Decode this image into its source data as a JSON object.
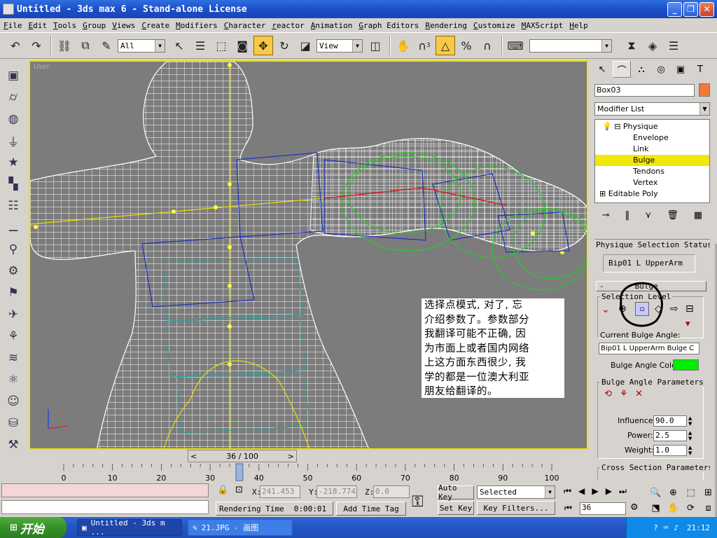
{
  "window": {
    "title": "Untitled - 3ds max 6 - Stand-alone License",
    "minimize": "_",
    "restore": "❐",
    "close": "✕"
  },
  "menu": [
    "File",
    "Edit",
    "Tools",
    "Group",
    "Views",
    "Create",
    "Modifiers",
    "Character",
    "reactor",
    "Animation",
    "Graph Editors",
    "Rendering",
    "Customize",
    "MAXScript",
    "Help"
  ],
  "toolbar": {
    "selection_filter": "All",
    "reference_coord": "View",
    "snap_label": "3"
  },
  "viewport": {
    "label": "User",
    "note_lines": [
      "选择点模式, 对了, 忘",
      "介绍参数了。参数部分",
      "我翻译可能不正确, 因",
      "为市面上或者国内网络",
      "上这方面东西很少, 我",
      "学的都是一位澳大利亚",
      "朋友给翻译的。"
    ]
  },
  "command_panel": {
    "object_name": "Box03",
    "object_color": "#f07a3c",
    "modifier_list": "Modifier List",
    "stack": [
      {
        "label": "Physique",
        "level": 0,
        "expand": "⊟"
      },
      {
        "label": "Envelope",
        "level": 1
      },
      {
        "label": "Link",
        "level": 1
      },
      {
        "label": "Bulge",
        "level": 1,
        "highlight": true
      },
      {
        "label": "Tendons",
        "level": 1
      },
      {
        "label": "Vertex",
        "level": 1
      },
      {
        "label": "Editable Poly",
        "level": 0,
        "expand": "⊞"
      }
    ],
    "physique_rollout": "Physique Selection Status",
    "selected_bone": "Bip01 L UpperArm",
    "bulge_rollout": "Bulge",
    "rollout_minus": "-",
    "selection_level": "Selection Level",
    "current_bulge_angle_label": "Current Bulge Angle:",
    "current_bulge_angle": "Bip01 L UpperArm Bulge C",
    "bulge_angle_color_label": "Bulge Angle Color:",
    "bulge_angle_color": "#00ee00",
    "bulge_params_title": "Bulge Angle Parameters",
    "influence_label": "Influence:",
    "influence": "90.0",
    "power_label": "Power:",
    "power": "2.5",
    "weight_label": "Weight:",
    "weight": "1.0",
    "cross_section_title": "Cross Section Parameters"
  },
  "timeline": {
    "frame": "36 / 100",
    "prev": "<",
    "next": ">",
    "ticks": [
      0,
      10,
      20,
      30,
      40,
      50,
      60,
      70,
      80,
      90,
      100
    ],
    "current_frame": 36,
    "total_frames": 100
  },
  "status": {
    "x_label": "X:",
    "x": "241.453",
    "y_label": "Y:",
    "y": "-218.774",
    "z_label": "Z:",
    "z": "0.0",
    "rendering_time_label": "Rendering Time",
    "rendering_time": "0:00:01",
    "add_time_tag": "Add Time Tag",
    "auto_key": "Auto Key",
    "set_key": "Set Key",
    "key_mode": "Selected",
    "key_filters": "Key Filters...",
    "frame_field": "36"
  },
  "taskbar": {
    "start": "开始",
    "items": [
      "Untitled - 3ds m ...",
      "21.JPG - 画图"
    ],
    "clock": "21:12"
  }
}
